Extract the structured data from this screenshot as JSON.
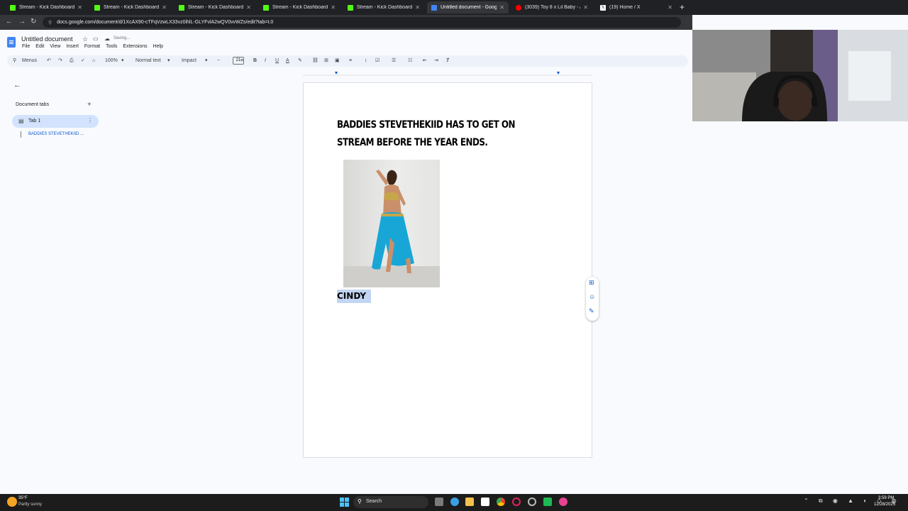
{
  "browser": {
    "tabs": [
      {
        "label": "Stream - Kick Dashboard",
        "favicon_color": "#53fc18",
        "active": false
      },
      {
        "label": "Stream - Kick Dashboard",
        "favicon_color": "#53fc18",
        "active": false
      },
      {
        "label": "Stream - Kick Dashboard",
        "favicon_color": "#53fc18",
        "active": false
      },
      {
        "label": "Stream - Kick Dashboard",
        "favicon_color": "#53fc18",
        "active": false
      },
      {
        "label": "Stream - Kick Dashboard",
        "favicon_color": "#53fc18",
        "active": false
      },
      {
        "label": "Untitled document - Google D",
        "favicon_color": "#4285f4",
        "active": true
      },
      {
        "label": "(3039) Toy 8 x Lil Baby - AL",
        "favicon_color": "#ff0000",
        "active": false
      },
      {
        "label": "(19) Home / X",
        "favicon_color": "#ffffff",
        "active": false
      }
    ],
    "url": "docs.google.com/document/d/1XcAX90-cTFqVzwLX33vz0ihlL-GLYFvlA2wQV0vvWZs/edit?tab=t.0"
  },
  "docs": {
    "title": "Untitled document",
    "saving_status": "Saving...",
    "menu": [
      "File",
      "Edit",
      "View",
      "Insert",
      "Format",
      "Tools",
      "Extensions",
      "Help"
    ],
    "toolbar": {
      "menus_label": "Menus",
      "zoom": "100%",
      "style": "Normal text",
      "font": "Impact",
      "font_size": "21"
    }
  },
  "sidebar": {
    "header": "Document tabs",
    "tab_label": "Tab 1",
    "outline_item": "BADDIES STEVETHEKIID ..."
  },
  "document": {
    "heading": "BADDIES STEVETHEKIID HAS TO GET ON STREAM BEFORE THE YEAR ENDS.",
    "caption": "CINDY"
  },
  "taskbar": {
    "weather_temp": "35°F",
    "weather_desc": "Partly sunny",
    "search_label": "Search",
    "time": "3:59 PM",
    "date": "12/28/2025"
  }
}
